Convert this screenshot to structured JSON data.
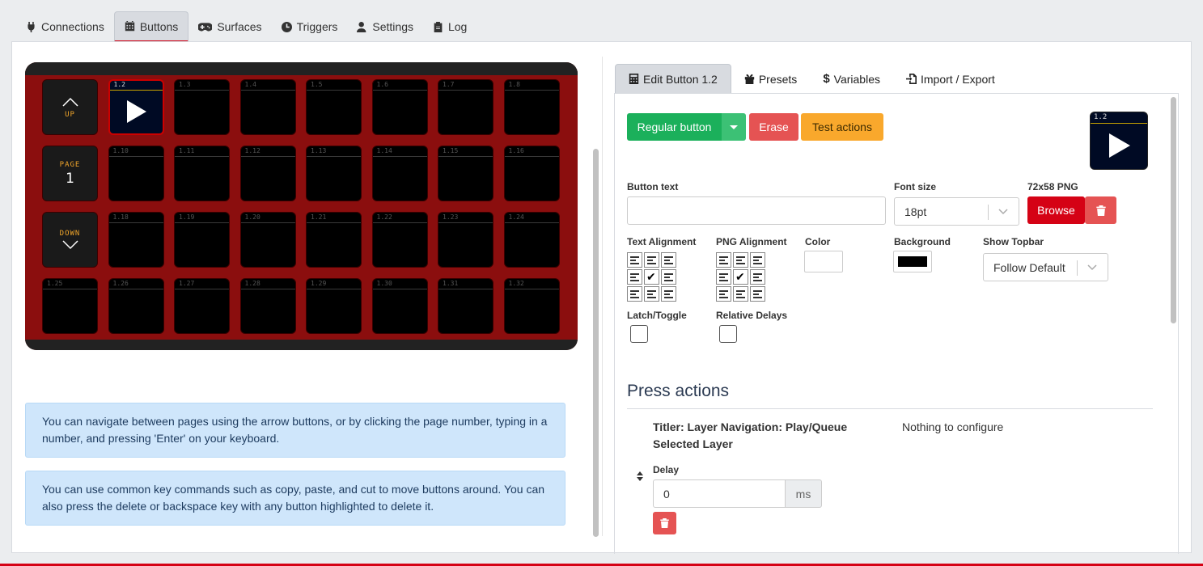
{
  "top_tabs": [
    {
      "label": "Connections",
      "icon": "plug-icon"
    },
    {
      "label": "Buttons",
      "icon": "calendar-grid-icon",
      "active": true
    },
    {
      "label": "Surfaces",
      "icon": "gamepad-icon"
    },
    {
      "label": "Triggers",
      "icon": "clock-icon"
    },
    {
      "label": "Settings",
      "icon": "user-cog-icon"
    },
    {
      "label": "Log",
      "icon": "clipboard-icon"
    }
  ],
  "grid": {
    "nav_up_label": "UP",
    "nav_page_label": "PAGE",
    "nav_page_number": "1",
    "nav_down_label": "DOWN",
    "keys": [
      "1.2",
      "1.3",
      "1.4",
      "1.5",
      "1.6",
      "1.7",
      "1.8",
      "1.10",
      "1.11",
      "1.12",
      "1.13",
      "1.14",
      "1.15",
      "1.16",
      "1.18",
      "1.19",
      "1.20",
      "1.21",
      "1.22",
      "1.23",
      "1.24",
      "1.25",
      "1.26",
      "1.27",
      "1.28",
      "1.29",
      "1.30",
      "1.31",
      "1.32"
    ],
    "selected_key": "1.2"
  },
  "info": {
    "nav_tip": "You can navigate between pages using the arrow buttons, or by clicking the page number, typing in a number, and pressing 'Enter' on your keyboard.",
    "key_tip": "You can use common key commands such as copy, paste, and cut to move buttons around. You can also press the delete or backspace key with any button highlighted to delete it."
  },
  "right_tabs": [
    {
      "label": "Edit Button 1.2",
      "icon": "calculator-icon",
      "active": true
    },
    {
      "label": "Presets",
      "icon": "gift-icon"
    },
    {
      "label": "Variables",
      "icon": "dollar-icon"
    },
    {
      "label": "Import / Export",
      "icon": "file-import-icon"
    }
  ],
  "editor": {
    "regular_button_label": "Regular button",
    "erase_label": "Erase",
    "test_actions_label": "Test actions",
    "preview_number": "1.2",
    "button_text_label": "Button text",
    "button_text_value": "",
    "font_size_label": "Font size",
    "font_size_value": "18pt",
    "png_label": "72x58 PNG",
    "browse_label": "Browse",
    "text_alignment_label": "Text Alignment",
    "png_alignment_label": "PNG Alignment",
    "color_label": "Color",
    "color_value": "#ffffff",
    "background_label": "Background",
    "background_value": "#000000",
    "show_topbar_label": "Show Topbar",
    "show_topbar_value": "Follow Default",
    "latch_label": "Latch/Toggle",
    "relative_delays_label": "Relative Delays",
    "press_actions_title": "Press actions",
    "action_name": "Titler: Layer Navigation: Play/Queue Selected Layer",
    "action_config": "Nothing to configure",
    "delay_label": "Delay",
    "delay_value": "0",
    "delay_unit": "ms"
  },
  "colors": {
    "accent": "#d50215",
    "success": "#2eb85c",
    "danger": "#e55353",
    "warning": "#f9b115",
    "device": "#8b0e0e"
  }
}
